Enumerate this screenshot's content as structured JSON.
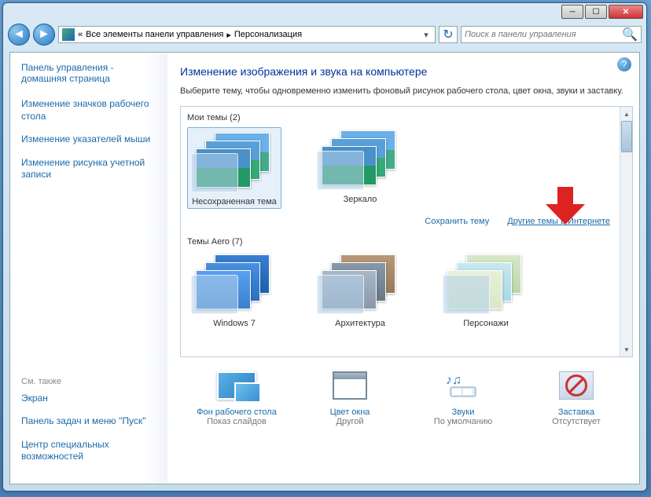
{
  "breadcrumb": {
    "prefix": "«",
    "seg1": "Все элементы панели управления",
    "sep": "▸",
    "seg2": "Персонализация"
  },
  "search": {
    "placeholder": "Поиск в панели управления"
  },
  "sidebar": {
    "home": "Панель управления - домашняя страница",
    "links": [
      "Изменение значков рабочего стола",
      "Изменение указателей мыши",
      "Изменение рисунка учетной записи"
    ],
    "seealso_title": "См. также",
    "seealso": [
      "Экран",
      "Панель задач и меню ''Пуск''",
      "Центр специальных возможностей"
    ]
  },
  "main": {
    "title": "Изменение изображения и звука на компьютере",
    "desc": "Выберите тему, чтобы одновременно изменить фоновый рисунок рабочего стола, цвет окна, звуки и заставку.",
    "group_my": "Мои темы (2)",
    "group_aero": "Темы Aero (7)",
    "my_themes": [
      "Несохраненная тема",
      "Зеркало"
    ],
    "aero_themes": [
      "Windows 7",
      "Архитектура",
      "Персонажи"
    ],
    "save_link": "Сохранить тему",
    "more_link": "Другие темы в Интернете"
  },
  "bottom": {
    "items": [
      {
        "label": "Фон рабочего стола",
        "sub": "Показ слайдов"
      },
      {
        "label": "Цвет окна",
        "sub": "Другой"
      },
      {
        "label": "Звуки",
        "sub": "По умолчанию"
      },
      {
        "label": "Заставка",
        "sub": "Отсутствует"
      }
    ]
  }
}
